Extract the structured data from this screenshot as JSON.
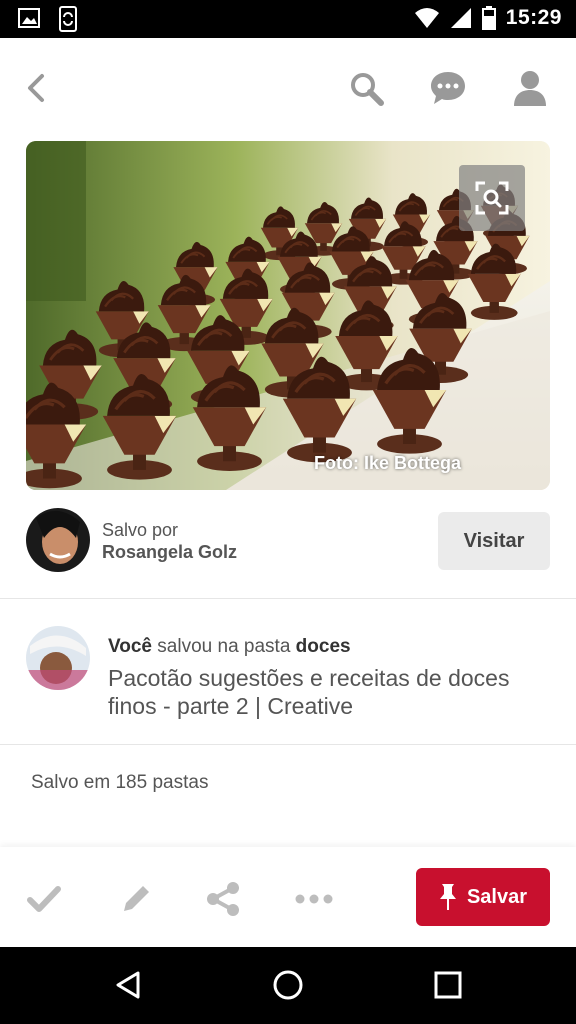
{
  "status_bar": {
    "time": "15:29",
    "icons": [
      "image-icon",
      "phone-sync-icon",
      "wifi-icon",
      "signal-icon",
      "battery-icon"
    ]
  },
  "top_bar": {
    "icons": [
      "back-icon",
      "search-icon",
      "messages-icon",
      "profile-icon"
    ]
  },
  "pin": {
    "image_watermark": "Foto: Ike Bottega"
  },
  "saved_by": {
    "label": "Salvo por",
    "name": "Rosangela Golz",
    "visit_label": "Visitar"
  },
  "activity": {
    "actor": "Você",
    "action": "salvou na pasta",
    "board": "doces",
    "description": "Pacotão sugestões e receitas de doces finos - parte 2 | Creative"
  },
  "saved_count": "Salvo em 185 pastas",
  "action_bar": {
    "save_label": "Salvar",
    "icons": [
      "check-icon",
      "edit-icon",
      "share-icon",
      "more-icon",
      "pin-icon"
    ],
    "accent": "#c8102e"
  },
  "nav_bar": {
    "icons": [
      "back-triangle-icon",
      "home-circle-icon",
      "recents-square-icon"
    ]
  }
}
